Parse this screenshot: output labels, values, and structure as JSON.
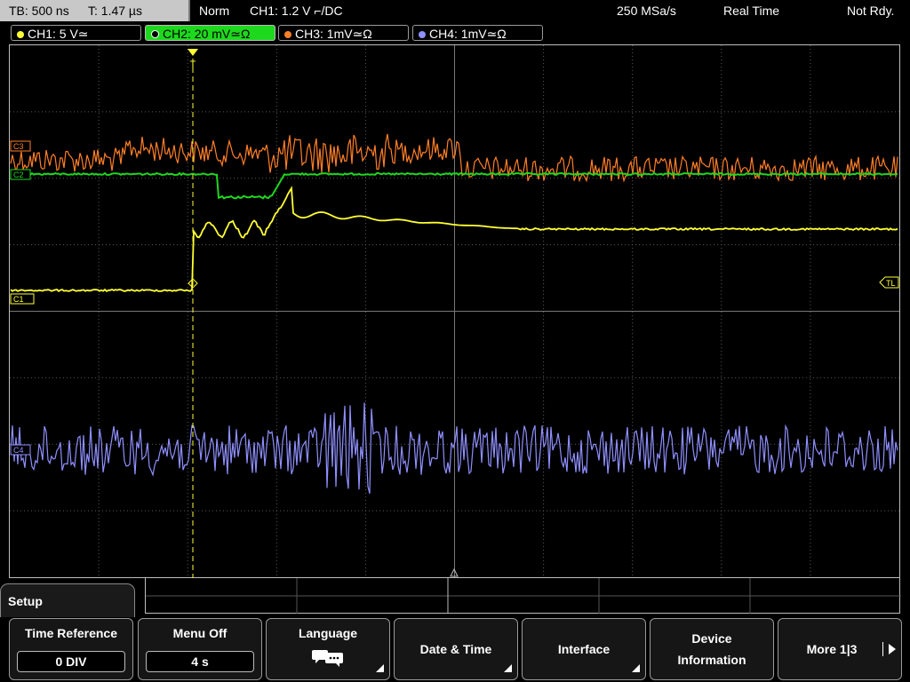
{
  "topbar": {
    "timebase": "TB: 500 ns",
    "trigger_time": "T: 1.47 µs",
    "trigger_mode": "Norm",
    "trigger_setting": "CH1: 1.2 V ⌐/DC",
    "sample_rate": "250 MSa/s",
    "acq_mode": "Real Time",
    "run_state": "Not Rdy."
  },
  "channels": [
    {
      "label": "CH1: 5 V≃",
      "color": "#ffff33",
      "active": false
    },
    {
      "label": "CH2: 20 mV≃Ω",
      "color": "#1ed81e",
      "active": true
    },
    {
      "label": "CH3: 1mV≃Ω",
      "color": "#ff7f27",
      "active": false
    },
    {
      "label": "CH4: 1mV≃Ω",
      "color": "#8f8fff",
      "active": false
    }
  ],
  "screen_markers": {
    "ch1_ref": "C1",
    "ch2_ref": "C2",
    "ch3_ref": "C3",
    "ch4_ref": "C4",
    "trigger_level": "TL",
    "trigger_pos": "T"
  },
  "colors": {
    "ch1": "#ffff33",
    "ch2": "#1ed81e",
    "ch3": "#ff7f27",
    "ch4": "#8f8fff",
    "grid": "#5a5a5a"
  },
  "menu": {
    "title": "Setup",
    "softkeys": [
      {
        "label": "Time Reference",
        "value": "0 DIV"
      },
      {
        "label": "Menu Off",
        "value": "4 s"
      },
      {
        "label": "Language",
        "icon": "speech-bubbles-icon"
      },
      {
        "label": "Date & Time"
      },
      {
        "label": "Interface"
      },
      {
        "label_line1": "Device",
        "label_line2": "Information"
      },
      {
        "label": "More 1|3"
      }
    ]
  }
}
